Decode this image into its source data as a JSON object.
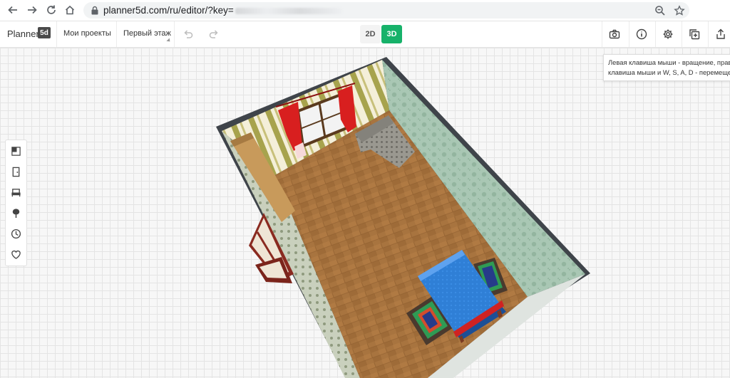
{
  "browser": {
    "url": "planner5d.com/ru/editor/?key=",
    "icons": [
      "back-arrow-icon",
      "forward-arrow-icon",
      "reload-icon",
      "home-icon",
      "lock-icon",
      "zoom-icon",
      "star-icon"
    ]
  },
  "toolbar": {
    "logo_text": "Planner",
    "logo_badge": "5d",
    "my_projects": "Мои проекты",
    "floor_select": "Первый этаж",
    "mode_2d": "2D",
    "mode_3d": "3D",
    "active_mode": "3D",
    "accent_color": "#17b26a",
    "right_icons": [
      "camera-icon",
      "info-icon",
      "settings-icon",
      "copy-icon",
      "share-icon"
    ]
  },
  "tooltip": {
    "line1": "Левая клавиша мыши - вращение, прав",
    "line2": "клавиша мыши и W, S, A, D - перемеще"
  },
  "left_panel": {
    "icons": [
      "rooms-icon",
      "doors-icon",
      "furniture-icon",
      "tree-icon",
      "history-icon",
      "favorites-icon"
    ]
  }
}
